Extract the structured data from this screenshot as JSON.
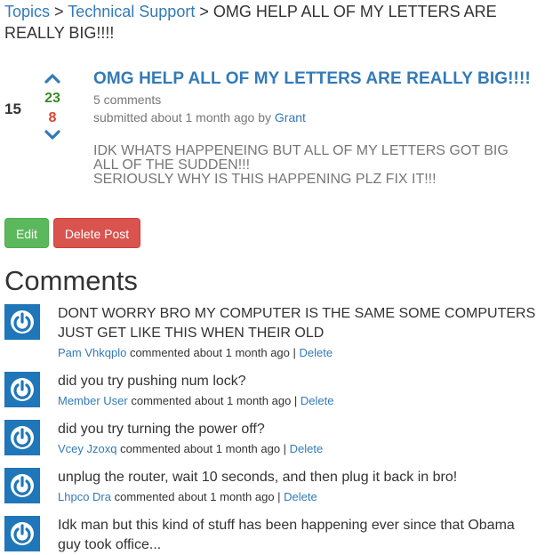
{
  "breadcrumb": {
    "topics": "Topics",
    "sep1": " > ",
    "category": "Technical Support",
    "sep2": " > ",
    "current": "OMG HELP ALL OF MY LETTERS ARE REALLY BIG!!!!"
  },
  "post": {
    "score": "15",
    "upvotes": "23",
    "downvotes": "8",
    "title": "OMG HELP ALL OF MY LETTERS ARE REALLY BIG!!!!",
    "comment_count": "5 comments",
    "submitted_prefix": "submitted about 1 month ago by ",
    "author": "Grant",
    "body_lines": [
      "IDK WHATS HAPPENEING BUT ALL OF MY LETTERS GOT BIG",
      "ALL OF THE SUDDEN!!!",
      "SERIOUSLY WHY IS THIS HAPPENING PLZ FIX IT!!!"
    ]
  },
  "actions": {
    "edit_label": "Edit",
    "delete_label": "Delete Post"
  },
  "comments_heading": "Comments",
  "comments": [
    {
      "text": "DONT WORRY BRO MY COMPUTER IS THE SAME SOME COMPUTERS JUST GET LIKE THIS WHEN THEIR OLD",
      "author": "Pam Vhkqplo",
      "meta": " commented about 1 month ago | ",
      "delete_label": "Delete"
    },
    {
      "text": "did you try pushing num lock?",
      "author": "Member User",
      "meta": " commented about 1 month ago | ",
      "delete_label": "Delete"
    },
    {
      "text": "did you try turning the power off?",
      "author": "Vcey Jzoxq",
      "meta": " commented about 1 month ago | ",
      "delete_label": "Delete"
    },
    {
      "text": "unplug the router, wait 10 seconds, and then plug it back in bro!",
      "author": "Lhpco Dra",
      "meta": " commented about 1 month ago | ",
      "delete_label": "Delete"
    },
    {
      "text": "Idk man but this kind of stuff has been happening ever since that Obama guy took office...",
      "author": "",
      "meta": "",
      "delete_label": ""
    }
  ],
  "colors": {
    "link": "#337ab7",
    "upvote": "#3c8a26",
    "downvote": "#d9442e",
    "edit_button": "#5cb85c",
    "delete_button": "#d9534f",
    "avatar": "#1f76b9"
  },
  "icons": {
    "upvote": "chevron-up-icon",
    "downvote": "chevron-down-icon",
    "avatar": "power-icon"
  }
}
